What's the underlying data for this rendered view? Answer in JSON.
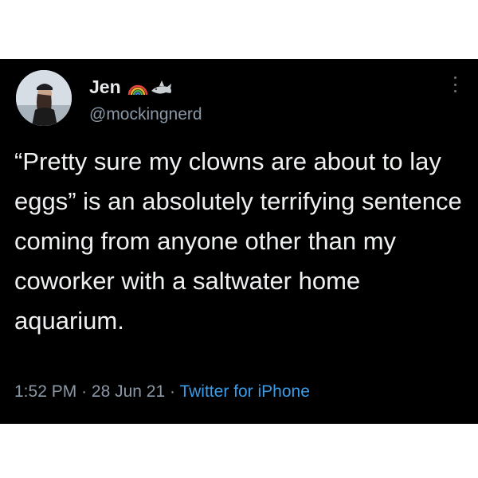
{
  "tweet": {
    "display_name": "Jen",
    "handle": "@mockingnerd",
    "name_emoji": [
      "rainbow-icon",
      "shark-icon"
    ],
    "text": "“Pretty sure my clowns are about to lay eggs” is an absolutely terrifying sentence coming from anyone other than my coworker with a saltwater home aquarium.",
    "time": "1:52 PM",
    "separator": "·",
    "date": "28 Jun 21",
    "source": "Twitter for iPhone"
  },
  "colors": {
    "background": "#000000",
    "text": "#e7e9ea",
    "secondary": "#8b98a5",
    "link": "#3a9be6"
  }
}
